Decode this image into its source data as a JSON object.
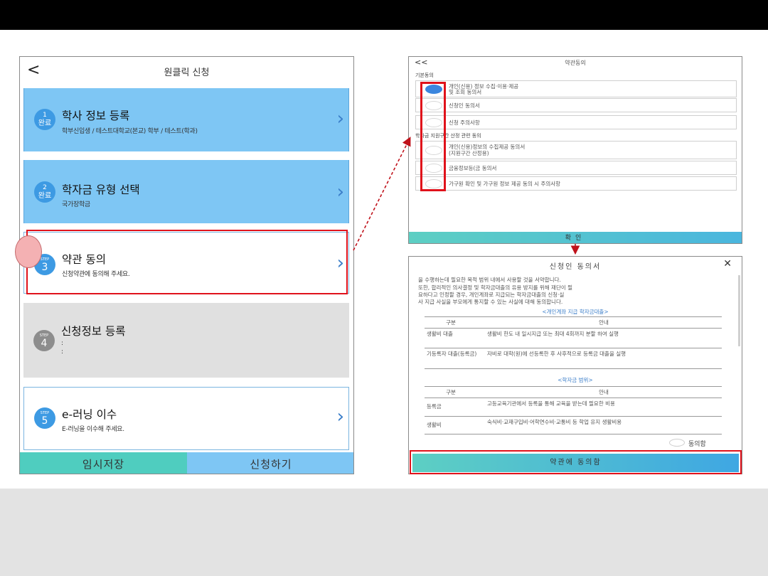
{
  "left": {
    "back": "<",
    "title": "원클릭 신청",
    "steps": [
      {
        "badge_top": "1",
        "badge_bottom": "완료",
        "title": "학사 정보 등록",
        "sub": "학부신입생 / 테스트대학교(본교) 학부 / 테스트(학과)",
        "state": "done"
      },
      {
        "badge_top": "2",
        "badge_bottom": "완료",
        "title": "학자금 유형 선택",
        "sub": "국가장학금",
        "state": "done"
      },
      {
        "badge_top": "STEP",
        "badge_bottom": "3",
        "title": "약관 동의",
        "sub": "신청약관에 동의해 주세요.",
        "state": "active"
      },
      {
        "badge_top": "STEP",
        "badge_bottom": "4",
        "title": "신청정보 등록",
        "sub1": ":",
        "sub2": ":",
        "state": "disabled"
      },
      {
        "badge_top": "STEP",
        "badge_bottom": "5",
        "title": "e-러닝 이수",
        "sub": "E-러닝을 이수해 주세요.",
        "state": "active"
      }
    ],
    "chevron": ">",
    "save_label": "임시저장",
    "apply_label": "신청하기"
  },
  "terms": {
    "back": "<<",
    "title": "약관동의",
    "section1": "기본동의",
    "section2": "학자금 지원구간 산정 관련 동의",
    "items": [
      {
        "label1": "개인(신용) 정보 수집·이용·제공",
        "label2": "및 조회 동의서",
        "checked": true
      },
      {
        "label1": "신청인 동의서",
        "checked": false
      },
      {
        "label1": "신청 주의사항",
        "checked": false
      },
      {
        "label1": "개인(신용)정보의 수집제공 동의서",
        "label2": "(지원구간 산정용)",
        "checked": false
      },
      {
        "label1": "금융정보등(금                                동의서",
        "checked": false
      },
      {
        "label1": "가구원 확인 및 가구원 정보 제공 동의 시 주의사항",
        "checked": false
      }
    ],
    "confirm": "확인"
  },
  "consent": {
    "title": "신청인 동의서",
    "close": "✕",
    "lines": [
      "을 수행하는데 필요한 목적 범위 내에서 사용할 것을 서약합니다.",
      "또한, 합리적인 의사결정 및 학자금대출의 유용 방지를 위해 재단이 필",
      "요하다고 인정할 경우, 개인계좌로 지급되는 학자금대출의 신청·실",
      "사 지급 사실을 부모에게 통지할 수 있는 사실에 대해 동의합니다."
    ],
    "subtitle1": "<개인계좌 지급 학자금대출>",
    "table1": {
      "header": [
        "구분",
        "안내"
      ],
      "rows": [
        {
          "c1": "생활비 대출",
          "c2": "생활비 한도 내 일시지급 또는 최대 4회까지 분할 하여 실행"
        },
        {
          "c1": "기등록자 대출(등록금)",
          "c2": "자비로 대학(원)에 선등록한 후 사후적으로 등록금 대출을 실행"
        }
      ]
    },
    "subtitle2": "<학자금 범위>",
    "table2": {
      "header": [
        "구분",
        "안내"
      ],
      "rows": [
        {
          "c1": "등록금",
          "c2": "고등교육기관에서 등록을 통해 교육을 받는데 필요한 비용"
        },
        {
          "c1": "생활비",
          "c2": "숙식비·교재구입비·어학연수비·교통비 등 학업 유지 생활비용"
        }
      ]
    },
    "agree": "동의함",
    "button": "약관에 동의함"
  }
}
